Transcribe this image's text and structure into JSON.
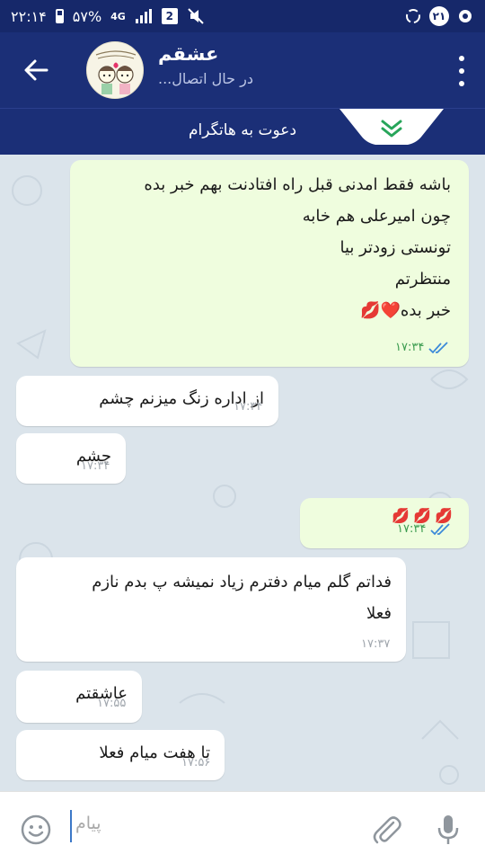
{
  "status_bar": {
    "time": "۲۲:۱۴",
    "battery": "۵۷%",
    "network": "4G",
    "sim_slot": "2",
    "notification_count": "۲۱"
  },
  "header": {
    "title": "عشقم",
    "status": "در حال اتصال..."
  },
  "invite": {
    "text": "دعوت به هاتگرام"
  },
  "messages": [
    {
      "direction": "out",
      "lines": [
        "باشه فقط امدنی قبل راه افتادنت بهم خبر بده",
        "چون امیرعلی هم خابه",
        "تونستی زودتر بیا",
        "منتظرتم",
        "خبر بده❤️💋"
      ],
      "time": "۱۷:۳۴",
      "read": true
    },
    {
      "direction": "in",
      "lines": [
        "از اداره زنگ میزنم چشم"
      ],
      "time": "۱۷:۳۴"
    },
    {
      "direction": "in",
      "lines": [
        "چشم"
      ],
      "time": "۱۷:۳۴"
    },
    {
      "direction": "out",
      "lines": [
        "💋💋💋"
      ],
      "time": "۱۷:۳۴",
      "read": true
    },
    {
      "direction": "in",
      "lines": [
        "فداتم گلم میام دفترم زیاد نمیشه پ بدم نازم",
        "فعلا"
      ],
      "time": "۱۷:۳۷"
    },
    {
      "direction": "in",
      "lines": [
        "عاشقتم"
      ],
      "time": "۱۷:۵۵"
    },
    {
      "direction": "in",
      "lines": [
        "تا هفت میام فعلا"
      ],
      "time": "۱۷:۵۶"
    }
  ],
  "input": {
    "placeholder": "پیام"
  },
  "colors": {
    "header_bg": "#1b2f77",
    "statusbar_bg": "#16286a",
    "out_bubble": "#effdde",
    "in_bubble": "#ffffff",
    "time_out": "#3a9b4e",
    "tick_blue": "#3c8ad9"
  },
  "icons": {
    "back": "arrow-left-icon",
    "menu": "more-vertical-icon",
    "invite_toggle": "chevron-double-down-icon",
    "emoji": "smiley-icon",
    "attach": "paperclip-icon",
    "mic": "microphone-icon",
    "read": "double-check-icon"
  }
}
